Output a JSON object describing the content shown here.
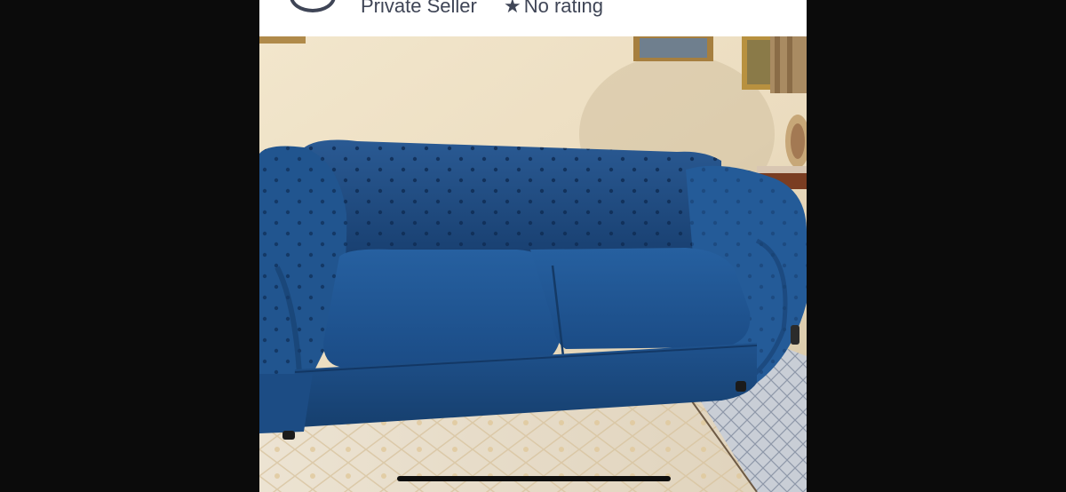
{
  "seller": {
    "name": "Private Seller",
    "rating_label": "No rating",
    "rating_icon": "star-icon",
    "avatar_icon": "user-avatar-icon"
  },
  "listing": {
    "photo": {
      "subject": "blue-tufted-sofa-photo"
    }
  },
  "colors": {
    "sofa": "#1f4f86",
    "wall": "#efe3c8",
    "rug": "#e8ddc8",
    "side_rug": "#c9ced6",
    "text": "#3f4556"
  }
}
